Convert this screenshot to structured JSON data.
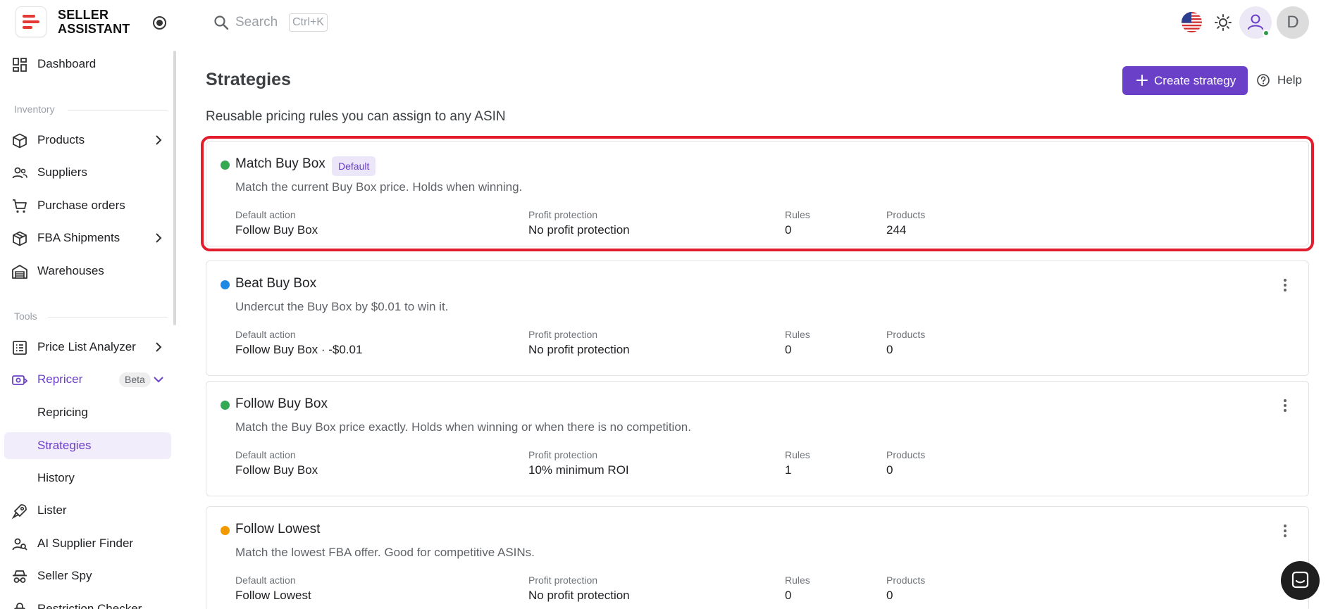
{
  "app": {
    "logo_line1": "SELLER",
    "logo_line2": "ASSISTANT"
  },
  "topbar": {
    "search_placeholder": "Search",
    "search_shortcut": "Ctrl+K",
    "avatar_initial": "D"
  },
  "sidebar": {
    "dashboard": "Dashboard",
    "section_inventory": "Inventory",
    "products": "Products",
    "suppliers": "Suppliers",
    "purchase_orders": "Purchase orders",
    "fba_shipments": "FBA Shipments",
    "warehouses": "Warehouses",
    "section_tools": "Tools",
    "price_list_analyzer": "Price List Analyzer",
    "repricer": "Repricer",
    "repricer_badge": "Beta",
    "repricing": "Repricing",
    "strategies": "Strategies",
    "history": "History",
    "lister": "Lister",
    "ai_supplier_finder": "AI Supplier Finder",
    "seller_spy": "Seller Spy",
    "restriction_checker": "Restriction Checker"
  },
  "main": {
    "title": "Strategies",
    "subtitle": "Reusable pricing rules you can assign to any ASIN",
    "create_label": "Create strategy",
    "help_label": "Help"
  },
  "labels": {
    "default_action": "Default action",
    "profit_protection": "Profit protection",
    "rules": "Rules",
    "products": "Products"
  },
  "strategies": [
    {
      "name": "Match Buy Box",
      "badge": "Default",
      "status_color": "#34a853",
      "description": "Match the current Buy Box price. Holds when winning.",
      "default_action": "Follow Buy Box",
      "profit_protection": "No profit protection",
      "rules": "0",
      "products": "244"
    },
    {
      "name": "Beat Buy Box",
      "status_color": "#1e88e5",
      "description": "Undercut the Buy Box by $0.01 to win it.",
      "default_action": "Follow Buy Box · -$0.01",
      "profit_protection": "No profit protection",
      "rules": "0",
      "products": "0"
    },
    {
      "name": "Follow Buy Box",
      "status_color": "#34a853",
      "description": "Match the Buy Box price exactly. Holds when winning or when there is no competition.",
      "default_action": "Follow Buy Box",
      "profit_protection": "10% minimum ROI",
      "rules": "1",
      "products": "0"
    },
    {
      "name": "Follow Lowest",
      "status_color": "#f29900",
      "description": "Match the lowest FBA offer. Good for competitive ASINs.",
      "default_action": "Follow Lowest",
      "profit_protection": "No profit protection",
      "rules": "0",
      "products": "0"
    }
  ],
  "colors": {
    "accent": "#6b40c9",
    "highlight": "#e11d2e"
  }
}
